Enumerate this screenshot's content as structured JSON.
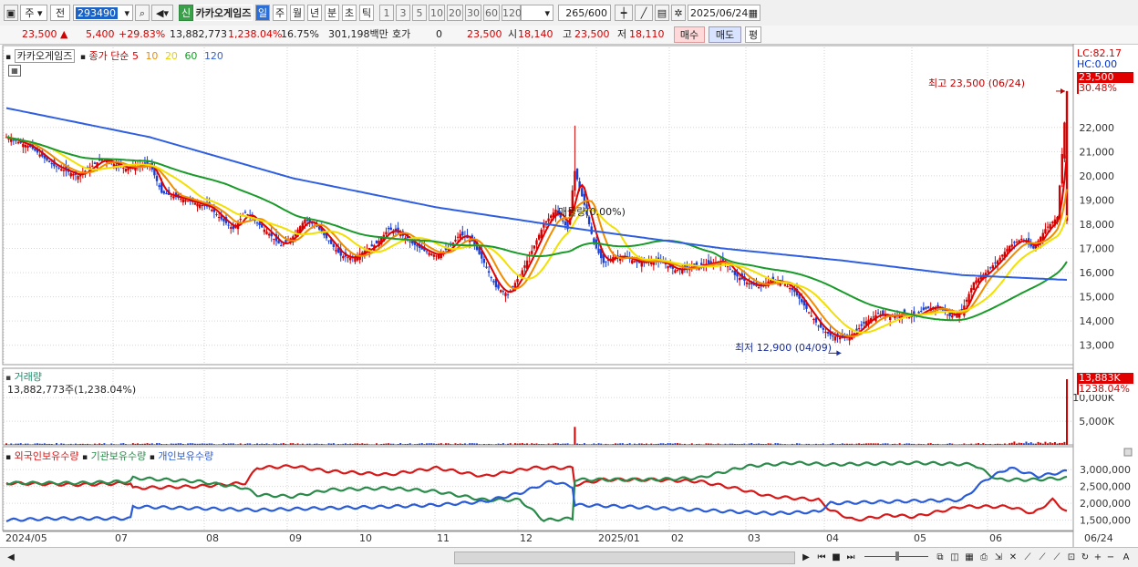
{
  "toolbar": {
    "market_tabs": [
      "주",
      "전"
    ],
    "code": "293490",
    "stock_name": "카카오게임즈",
    "credit_tag": "신",
    "period_buttons": [
      "일",
      "주",
      "월",
      "년",
      "분",
      "초",
      "틱"
    ],
    "active_period": "일",
    "interval_buttons": [
      "1",
      "3",
      "5",
      "10",
      "20",
      "30",
      "60",
      "120"
    ],
    "count": "265",
    "count_total": "/600",
    "date": "2025/06/24"
  },
  "quote": {
    "price": "23,500",
    "change": "5,400",
    "change_pct": "+29.83%",
    "volume": "13,882,773",
    "volume_pct": "1,238.04%",
    "turnover": "16.75%",
    "amount": "301,198백만",
    "hoga_label": "호가",
    "hoga_value": "0",
    "hoga_price": "23,500",
    "open_label": "시",
    "open": "18,140",
    "high_label": "고",
    "high": "23,500",
    "low_label": "저",
    "low": "18,110",
    "buy": "매수",
    "sell": "매도",
    "eval": "평"
  },
  "price_panel": {
    "legend_name": "카카오게임즈",
    "legend_prefix": "종가 단순",
    "ma_labels": [
      "5",
      "10",
      "20",
      "60",
      "120"
    ],
    "lc": "LC:82.17",
    "hc": "HC:0.00",
    "cur_price_tag": "23,500",
    "cur_pct_tag": "30.48%",
    "high_note": "최고 23,500 (06/24)",
    "low_note": "최저 12,900 (04/09)",
    "mid_note": "매물량(0.00%)"
  },
  "volume_panel": {
    "title": "거래량",
    "value": "13,882,773주(1,238.04%)",
    "tag_value": "13,883K",
    "tag_pct": "1238.04%"
  },
  "holding_panel": {
    "legends": [
      "외국인보유수량",
      "기관보유수량",
      "개인보유수량"
    ]
  },
  "colors": {
    "up": "#d20000",
    "down": "#1a3fd6",
    "ma5": "#e00000",
    "ma10": "#f08c00",
    "ma20": "#f2e000",
    "ma60": "#1a9a2a",
    "ma120": "#2f5fe0",
    "foreign": "#d61818",
    "institution": "#2a8a4a",
    "individual": "#2a5bd6"
  },
  "chart_data": [
    {
      "type": "candlestick",
      "title": "카카오게임즈",
      "x_ticks": [
        "2024/05",
        "07",
        "08",
        "09",
        "10",
        "11",
        "12",
        "2025/01",
        "02",
        "03",
        "04",
        "05",
        "06",
        "06/24"
      ],
      "ylim": [
        12500,
        23800
      ],
      "y_ticks": [
        13000,
        14000,
        15000,
        16000,
        17000,
        18000,
        19000,
        20000,
        21000,
        22000
      ],
      "close_path": [
        [
          0,
          21600
        ],
        [
          10,
          21200
        ],
        [
          20,
          20400
        ],
        [
          30,
          20000
        ],
        [
          40,
          20700
        ],
        [
          50,
          20300
        ],
        [
          60,
          20500
        ],
        [
          65,
          19300
        ],
        [
          75,
          19000
        ],
        [
          85,
          18700
        ],
        [
          90,
          18200
        ],
        [
          95,
          17800
        ],
        [
          100,
          18500
        ],
        [
          110,
          17600
        ],
        [
          115,
          17100
        ],
        [
          120,
          17500
        ],
        [
          125,
          18200
        ],
        [
          130,
          17900
        ],
        [
          135,
          17300
        ],
        [
          140,
          16700
        ],
        [
          145,
          16600
        ],
        [
          150,
          16900
        ],
        [
          155,
          17200
        ],
        [
          160,
          17800
        ],
        [
          165,
          17600
        ],
        [
          170,
          17200
        ],
        [
          175,
          16900
        ],
        [
          180,
          16700
        ],
        [
          185,
          17000
        ],
        [
          190,
          17600
        ],
        [
          195,
          17300
        ],
        [
          200,
          16400
        ],
        [
          205,
          15400
        ],
        [
          210,
          15100
        ],
        [
          215,
          15900
        ],
        [
          220,
          16900
        ],
        [
          225,
          18000
        ],
        [
          230,
          18600
        ],
        [
          235,
          17800
        ],
        [
          238,
          20200
        ],
        [
          242,
          18800
        ],
        [
          246,
          17200
        ],
        [
          250,
          16400
        ],
        [
          255,
          16700
        ],
        [
          260,
          16600
        ],
        [
          265,
          16400
        ],
        [
          270,
          16500
        ],
        [
          275,
          16400
        ],
        [
          280,
          16100
        ],
        [
          285,
          16200
        ],
        [
          290,
          16300
        ],
        [
          300,
          16500
        ],
        [
          305,
          15900
        ],
        [
          310,
          15600
        ],
        [
          315,
          15400
        ],
        [
          320,
          15700
        ],
        [
          325,
          15600
        ],
        [
          330,
          15200
        ],
        [
          335,
          14500
        ],
        [
          340,
          13800
        ],
        [
          345,
          13400
        ],
        [
          350,
          13300
        ],
        [
          355,
          13500
        ],
        [
          360,
          14000
        ],
        [
          365,
          14300
        ],
        [
          370,
          14200
        ],
        [
          375,
          14300
        ],
        [
          380,
          14200
        ],
        [
          385,
          14500
        ],
        [
          390,
          14600
        ],
        [
          395,
          14200
        ],
        [
          400,
          14400
        ],
        [
          405,
          15600
        ],
        [
          410,
          16000
        ],
        [
          415,
          16500
        ],
        [
          420,
          17100
        ],
        [
          425,
          17400
        ],
        [
          430,
          17000
        ],
        [
          435,
          17800
        ],
        [
          440,
          18300
        ],
        [
          444,
          23500
        ]
      ],
      "ma": [
        {
          "name": "5"
        },
        {
          "name": "10"
        },
        {
          "name": "20"
        },
        {
          "name": "60"
        },
        {
          "name": "120",
          "path": [
            [
              0,
              22800
            ],
            [
              60,
              21600
            ],
            [
              120,
              19900
            ],
            [
              180,
              18700
            ],
            [
              240,
              17800
            ],
            [
              300,
              17000
            ],
            [
              350,
              16500
            ],
            [
              400,
              15900
            ],
            [
              444,
              15700
            ]
          ]
        }
      ],
      "high_point": {
        "x": 444,
        "value": 23500,
        "date": "06/24"
      },
      "low_point": {
        "x": 351,
        "value": 12900,
        "date": "04/09"
      }
    },
    {
      "type": "bar",
      "title": "거래량",
      "ylim": [
        0,
        13883000
      ],
      "y_ticks": [
        5000000,
        10000000
      ],
      "y_tick_labels": [
        "5,000K",
        "10,000K"
      ],
      "spikes": [
        {
          "x": 238,
          "value": 3800000
        },
        {
          "x": 444,
          "value": 13882773
        }
      ],
      "baseline_value": 250000
    },
    {
      "type": "line",
      "title": "보유수량",
      "ylim": [
        1300000,
        3300000
      ],
      "y_ticks": [
        1500000,
        2000000,
        2500000,
        3000000
      ],
      "y_tick_labels": [
        "1,500,000",
        "2,000,000",
        "2,500,000",
        "3,000,000"
      ],
      "series": [
        {
          "name": "외국인보유수량",
          "path": [
            [
              0,
              2600000
            ],
            [
              30,
              2550000
            ],
            [
              52,
              2600000
            ],
            [
              53,
              2450000
            ],
            [
              80,
              2500000
            ],
            [
              100,
              2600000
            ],
            [
              105,
              3050000
            ],
            [
              120,
              3100000
            ],
            [
              135,
              2950000
            ],
            [
              160,
              2850000
            ],
            [
              180,
              3050000
            ],
            [
              200,
              2800000
            ],
            [
              220,
              3050000
            ],
            [
              237,
              3050000
            ],
            [
              238,
              2550000
            ],
            [
              250,
              2700000
            ],
            [
              270,
              2700000
            ],
            [
              290,
              2650000
            ],
            [
              305,
              2450000
            ],
            [
              320,
              2200000
            ],
            [
              340,
              2100000
            ],
            [
              345,
              1800000
            ],
            [
              355,
              1500000
            ],
            [
              370,
              1650000
            ],
            [
              380,
              1600000
            ],
            [
              400,
              1900000
            ],
            [
              420,
              1900000
            ],
            [
              430,
              1700000
            ],
            [
              438,
              2100000
            ],
            [
              444,
              1750000
            ]
          ]
        },
        {
          "name": "기관보유수량",
          "path": [
            [
              0,
              2600000
            ],
            [
              30,
              2600000
            ],
            [
              52,
              2650000
            ],
            [
              53,
              2750000
            ],
            [
              80,
              2650000
            ],
            [
              100,
              2450000
            ],
            [
              105,
              2250000
            ],
            [
              120,
              2200000
            ],
            [
              135,
              2400000
            ],
            [
              160,
              2450000
            ],
            [
              180,
              2350000
            ],
            [
              200,
              2100000
            ],
            [
              215,
              2100000
            ],
            [
              225,
              1500000
            ],
            [
              237,
              1550000
            ],
            [
              238,
              2700000
            ],
            [
              250,
              2700000
            ],
            [
              270,
              2700000
            ],
            [
              290,
              2750000
            ],
            [
              310,
              3100000
            ],
            [
              330,
              3200000
            ],
            [
              345,
              3150000
            ],
            [
              380,
              3200000
            ],
            [
              405,
              3150000
            ],
            [
              415,
              2700000
            ],
            [
              430,
              2700000
            ],
            [
              444,
              2750000
            ]
          ]
        },
        {
          "name": "개인보유수량",
          "path": [
            [
              0,
              1500000
            ],
            [
              20,
              1550000
            ],
            [
              52,
              1550000
            ],
            [
              53,
              1900000
            ],
            [
              80,
              1850000
            ],
            [
              105,
              1800000
            ],
            [
              130,
              1850000
            ],
            [
              160,
              1900000
            ],
            [
              180,
              1950000
            ],
            [
              200,
              2050000
            ],
            [
              215,
              2300000
            ],
            [
              228,
              2650000
            ],
            [
              237,
              2500000
            ],
            [
              238,
              1950000
            ],
            [
              260,
              1900000
            ],
            [
              290,
              1800000
            ],
            [
              320,
              1700000
            ],
            [
              340,
              1750000
            ],
            [
              345,
              2000000
            ],
            [
              370,
              2050000
            ],
            [
              400,
              2100000
            ],
            [
              410,
              2700000
            ],
            [
              420,
              3050000
            ],
            [
              432,
              2800000
            ],
            [
              444,
              2950000
            ]
          ]
        }
      ]
    }
  ],
  "x_axis_labels": [
    "2024/05",
    "07",
    "08",
    "09",
    "10",
    "11",
    "12",
    "2025/01",
    "02",
    "03",
    "04",
    "05",
    "06",
    "06/24"
  ]
}
